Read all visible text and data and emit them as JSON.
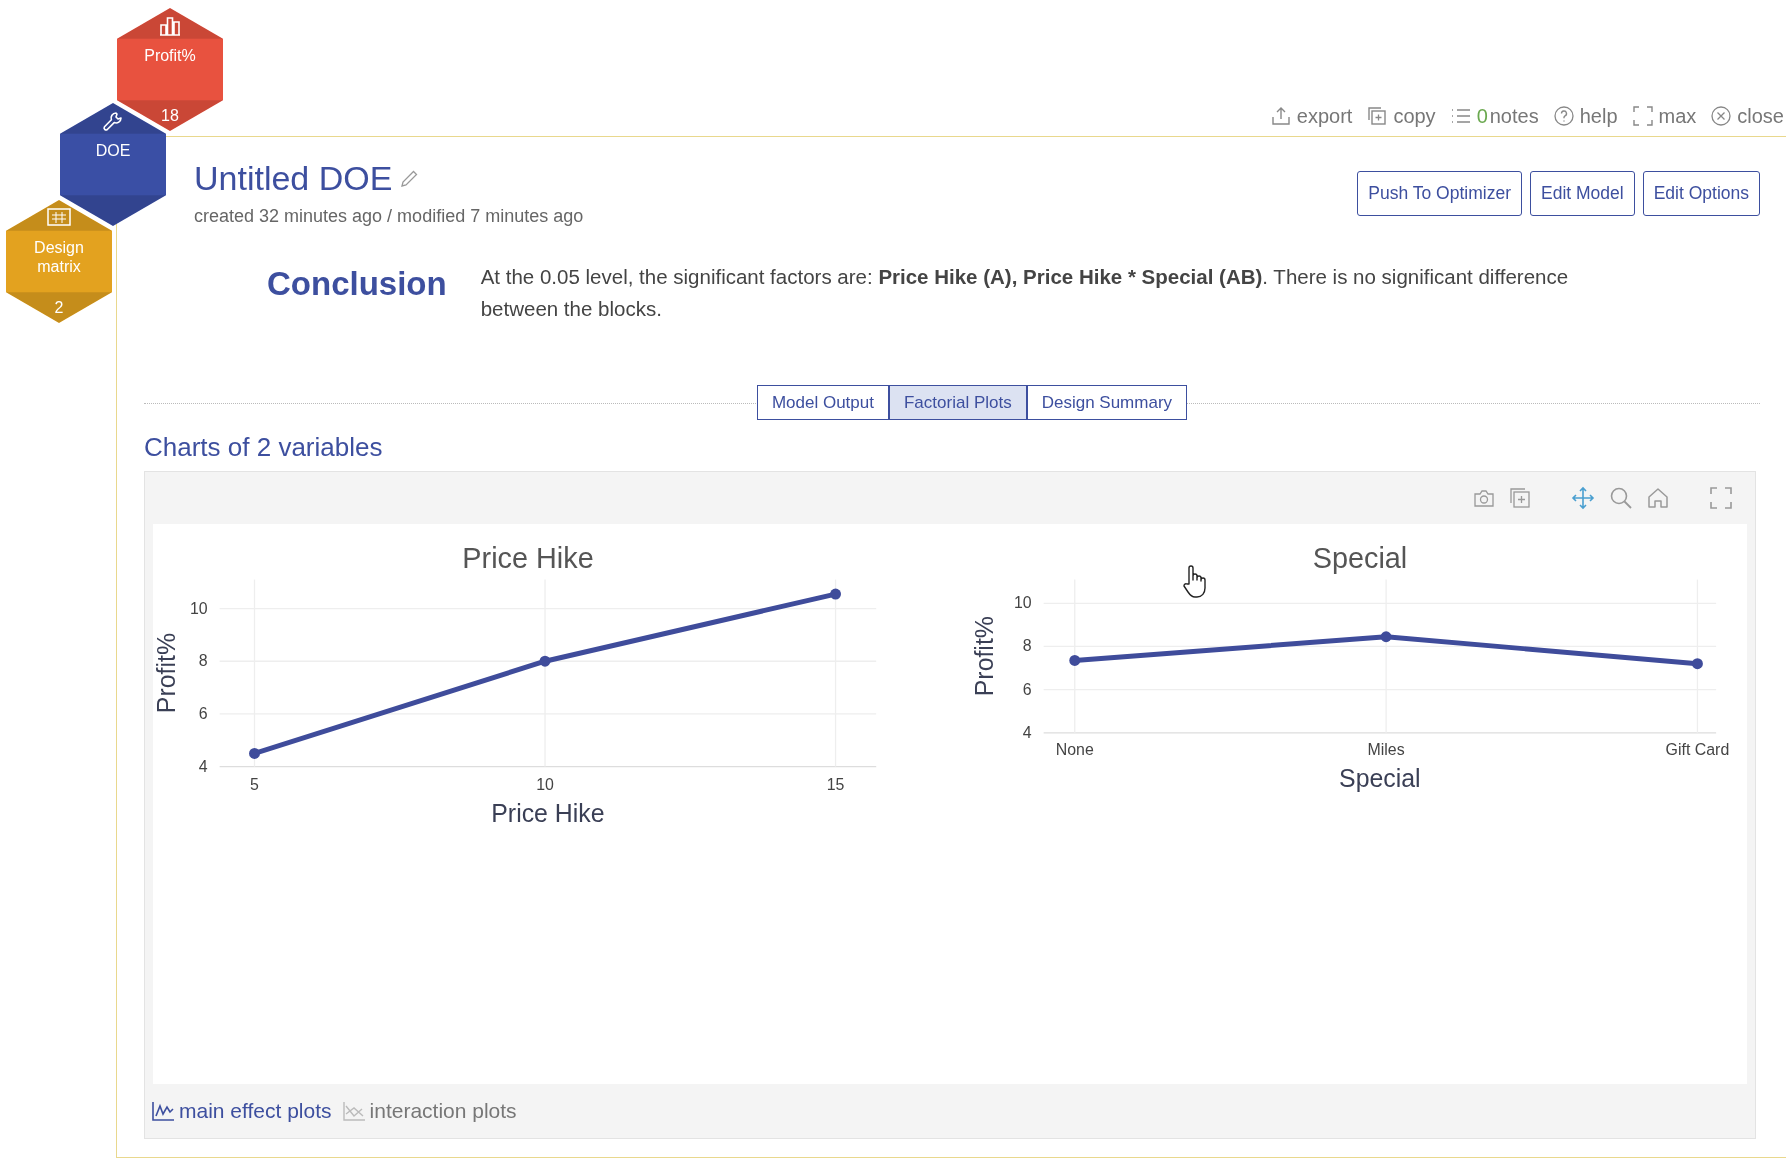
{
  "hex_tiles": [
    {
      "kind": "chart",
      "label": "Profit%",
      "count": "18",
      "color": "#e8523f"
    },
    {
      "kind": "tool",
      "label": "DOE",
      "color": "#3a4fa5"
    },
    {
      "kind": "matrix",
      "label": "Design matrix",
      "count": "2",
      "color": "#e3a21f"
    }
  ],
  "toolbar": [
    {
      "kind": "export",
      "label": "export"
    },
    {
      "kind": "copy",
      "label": "copy"
    },
    {
      "kind": "notes",
      "count": "0",
      "label": "notes"
    },
    {
      "kind": "help",
      "label": "help"
    },
    {
      "kind": "max",
      "label": "max"
    },
    {
      "kind": "close",
      "label": "close"
    }
  ],
  "document": {
    "title": "Untitled DOE",
    "meta": "created 32 minutes ago / modified 7 minutes ago"
  },
  "buttons": [
    "Push To Optimizer",
    "Edit Model",
    "Edit Options"
  ],
  "conclusion": {
    "heading": "Conclusion",
    "parts": [
      {
        "text": "At the 0.05 level, the significant factors are: ",
        "bold": false
      },
      {
        "text": "Price Hike (A), Price Hike * Special (AB)",
        "bold": true
      },
      {
        "text": ". There is no significant difference between the blocks.",
        "bold": false
      }
    ]
  },
  "tabs": [
    {
      "label": "Model Output",
      "selected": false
    },
    {
      "label": "Factorial Plots",
      "selected": true
    },
    {
      "label": "Design Summary",
      "selected": false
    }
  ],
  "charts_heading": "Charts of 2 variables",
  "charts": [
    {
      "chart_data": {
        "type": "line",
        "title": "Price Hike",
        "xlabel": "Price Hike",
        "ylabel": "Profit%",
        "x": [
          5,
          10,
          15
        ],
        "xticks": [
          5,
          10,
          15
        ],
        "yticks": [
          4,
          6,
          8,
          10
        ],
        "xlim": [
          4.4,
          15.7
        ],
        "ylim": [
          4,
          11.1
        ],
        "grid": true,
        "series": [
          {
            "color": "#3f4c9b",
            "marker": true,
            "values": [
              4.5,
              8,
              10.55
            ]
          }
        ]
      }
    },
    {
      "chart_data": {
        "type": "line",
        "title": "Special",
        "xlabel": "Special",
        "ylabel": "Profit%",
        "categories": [
          "None",
          "Miles",
          "Gift Card"
        ],
        "yticks": [
          4,
          6,
          8,
          10
        ],
        "ylim": [
          4,
          11.1
        ],
        "grid": true,
        "series": [
          {
            "color": "#3f4c9b",
            "marker": true,
            "values": [
              7.35,
              8.45,
              7.2
            ]
          }
        ]
      }
    }
  ],
  "footer_links": [
    {
      "kind": "main",
      "label": "main effect plots",
      "selected": true
    },
    {
      "kind": "interaction",
      "label": "interaction plots",
      "selected": false
    }
  ]
}
